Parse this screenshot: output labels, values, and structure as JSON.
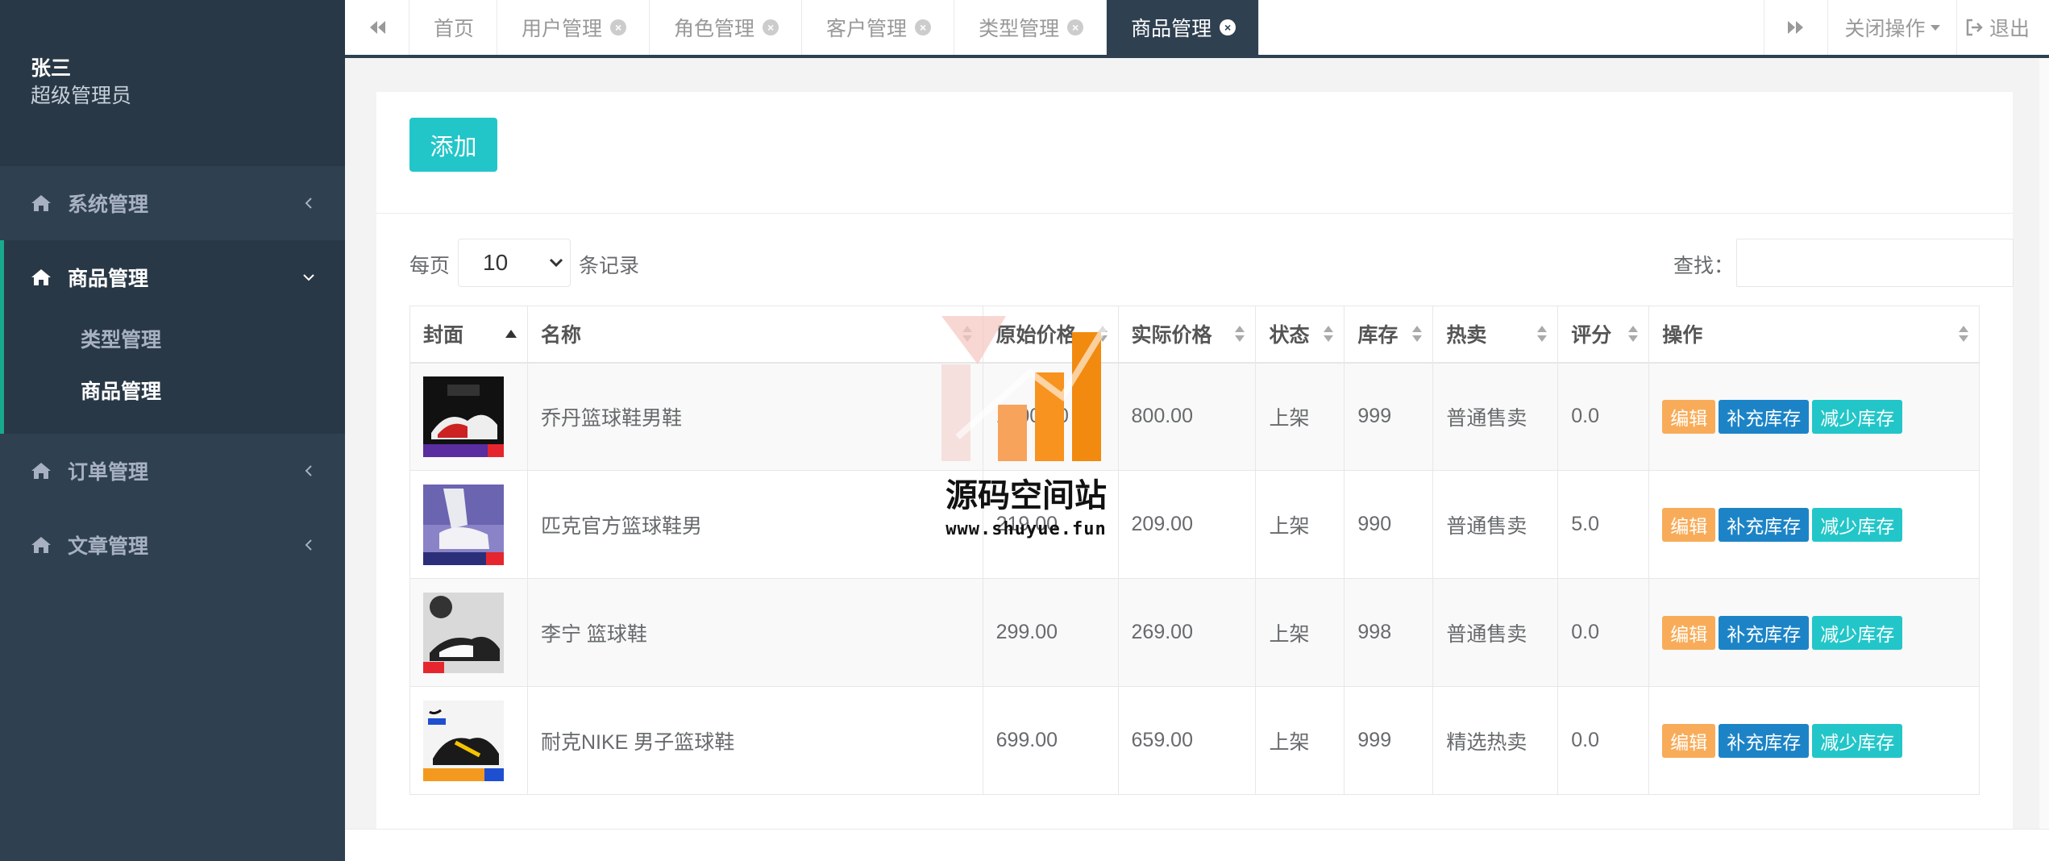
{
  "profile": {
    "name": "张三",
    "role": "超级管理员"
  },
  "sidebar": {
    "groups": [
      {
        "label": "系统管理",
        "expanded": false
      },
      {
        "label": "商品管理",
        "expanded": true,
        "children": [
          "类型管理",
          "商品管理"
        ],
        "current_child": "商品管理"
      },
      {
        "label": "订单管理",
        "expanded": false
      },
      {
        "label": "文章管理",
        "expanded": false
      }
    ]
  },
  "tabs": [
    {
      "label": "首页",
      "closable": false
    },
    {
      "label": "用户管理",
      "closable": true
    },
    {
      "label": "角色管理",
      "closable": true
    },
    {
      "label": "客户管理",
      "closable": true
    },
    {
      "label": "类型管理",
      "closable": true
    },
    {
      "label": "商品管理",
      "closable": true,
      "active": true
    }
  ],
  "topbar": {
    "close_ops": "关闭操作",
    "logout": "退出"
  },
  "panel": {
    "add_label": "添加"
  },
  "toolbar": {
    "length_prefix": "每页",
    "length_value": "10",
    "length_suffix": "条记录",
    "search_label": "查找："
  },
  "table": {
    "columns": [
      "封面",
      "名称",
      "原始价格",
      "实际价格",
      "状态",
      "库存",
      "热卖",
      "评分",
      "操作"
    ],
    "rows": [
      {
        "name": "乔丹篮球鞋男鞋",
        "orig_price": "1000.00",
        "price": "800.00",
        "status": "上架",
        "stock": "999",
        "hot": "普通售卖",
        "rating": "0.0",
        "cover_icon": "jordan-shoe-thumbnail"
      },
      {
        "name": "匹克官方篮球鞋男",
        "orig_price": "219.00",
        "price": "209.00",
        "status": "上架",
        "stock": "990",
        "hot": "普通售卖",
        "rating": "5.0",
        "cover_icon": "peak-shoe-thumbnail"
      },
      {
        "name": "李宁 篮球鞋",
        "orig_price": "299.00",
        "price": "269.00",
        "status": "上架",
        "stock": "998",
        "hot": "普通售卖",
        "rating": "0.0",
        "cover_icon": "lining-shoe-thumbnail"
      },
      {
        "name": "耐克NIKE 男子篮球鞋",
        "orig_price": "699.00",
        "price": "659.00",
        "status": "上架",
        "stock": "999",
        "hot": "精选热卖",
        "rating": "0.0",
        "cover_icon": "nike-shoe-thumbnail"
      }
    ],
    "actions": {
      "edit": "编辑",
      "add_stock": "补充库存",
      "reduce_stock": "减少库存"
    }
  },
  "watermark": {
    "title": "源码空间站",
    "url": "www.shuyue.fun"
  },
  "colors": {
    "sidebar": "#2f4050",
    "sidebar_dark": "#293846",
    "accent": "#23c6c8",
    "edit": "#f8ac59",
    "primary": "#1c84c6"
  }
}
